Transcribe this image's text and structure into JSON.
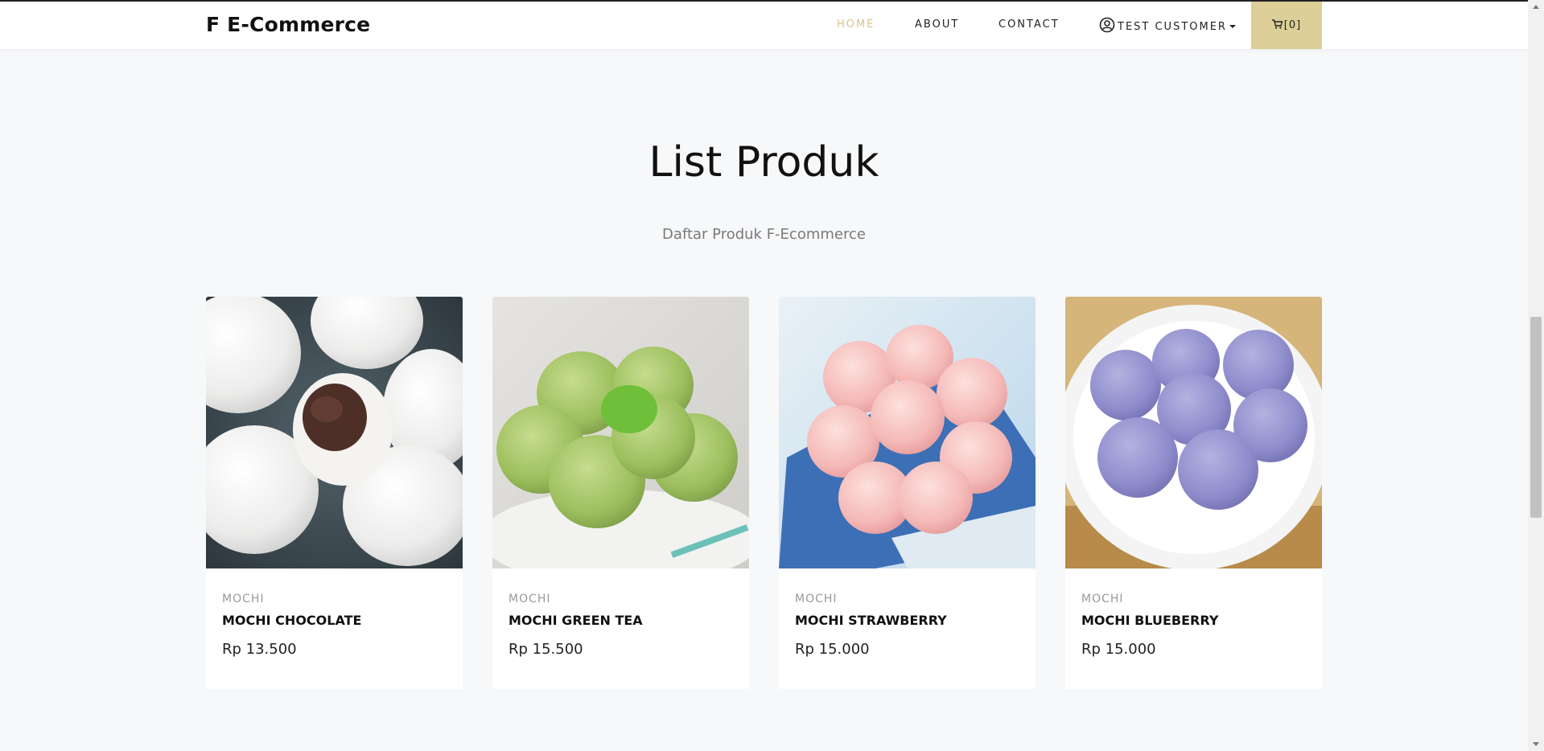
{
  "navbar": {
    "brand": "F E-Commerce",
    "links": [
      {
        "label": "HOME",
        "active": true
      },
      {
        "label": "ABOUT",
        "active": false
      },
      {
        "label": "CONTACT",
        "active": false
      }
    ],
    "user": {
      "label": "TEST CUSTOMER",
      "icon": "user-circle-icon"
    },
    "cart": {
      "label": "[0]",
      "icon": "cart-icon"
    },
    "colors": {
      "active": "#d8c48a",
      "cart_bg": "#dccf97"
    }
  },
  "section": {
    "title": "List Produk",
    "subtitle": "Daftar Produk F-Ecommerce"
  },
  "products": [
    {
      "category": "MOCHI",
      "name": "MOCHI CHOCOLATE",
      "price": "Rp 13.500",
      "image": "white mochi with chocolate filling"
    },
    {
      "category": "MOCHI",
      "name": "MOCHI GREEN TEA",
      "price": "Rp 15.500",
      "image": "green tea mochi"
    },
    {
      "category": "MOCHI",
      "name": "MOCHI STRAWBERRY",
      "price": "Rp 15.000",
      "image": "pink strawberry mochi"
    },
    {
      "category": "MOCHI",
      "name": "MOCHI BLUEBERRY",
      "price": "Rp 15.000",
      "image": "purple blueberry mochi"
    }
  ]
}
